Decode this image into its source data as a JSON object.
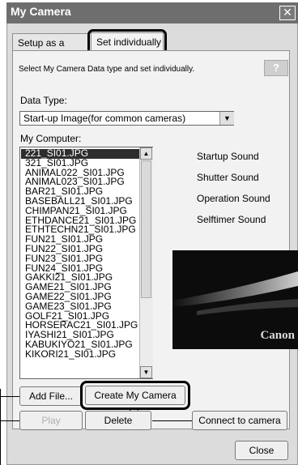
{
  "window": {
    "title": "My Camera",
    "close_glyph": "✕",
    "close_icon": "close-icon"
  },
  "tabs": [
    {
      "label": "Setup as a theme",
      "active": false
    },
    {
      "label": "Set individually",
      "active": true
    }
  ],
  "instruction": "Select My Camera Data type and set individually.",
  "help_button": "?",
  "data_type": {
    "label": "Data Type:",
    "value": "Start-up Image(for common cameras)",
    "dropdown_icon": "chevron-down-icon"
  },
  "my_computer": {
    "label": "My Computer:",
    "files": [
      "221_SI01.JPG",
      "321_SI01.JPG",
      "ANIMAL022_SI01.JPG",
      "ANIMAL023_SI01.JPG",
      "BAR21_SI01.JPG",
      "BASEBALL21_SI01.JPG",
      "CHIMPAN21_SI01.JPG",
      "ETHDANCE21_SI01.JPG",
      "ETHTECHN21_SI01.JPG",
      "FUN21_SI01.JPG",
      "FUN22_SI01.JPG",
      "FUN23_SI01.JPG",
      "FUN24_SI01.JPG",
      "GAKKI21_SI01.JPG",
      "GAME21_SI01.JPG",
      "GAME22_SI01.JPG",
      "GAME23_SI01.JPG",
      "GOLF21_SI01.JPG",
      "HORSERAC21_SI01.JPG",
      "IYASHI21_SI01.JPG",
      "KABUKIYO21_SI01.JPG",
      "KIKORI21_SI01.JPG"
    ],
    "selected_index": 0
  },
  "sounds": [
    "Startup Sound",
    "Shutter Sound",
    "Operation Sound",
    "Selftimer Sound"
  ],
  "preview": {
    "brand": "Canon"
  },
  "buttons": {
    "add_file": "Add File...",
    "create": "Create My Camera data",
    "play": "Play",
    "delete": "Delete",
    "connect": "Connect to camera",
    "close": "Close"
  },
  "colors": {
    "titlebar": "#6e6e6e",
    "selection": "#2d2d2d",
    "highlight_border": "#000000"
  }
}
